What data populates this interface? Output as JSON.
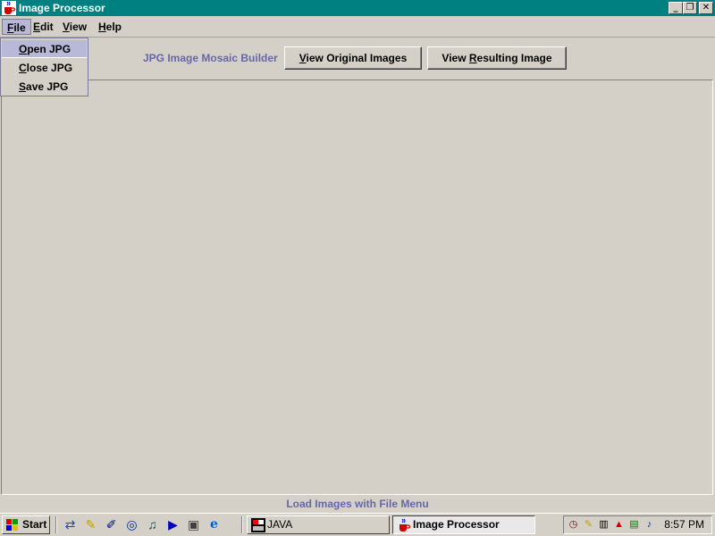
{
  "window": {
    "title": "Image Processor",
    "controls": {
      "minimize": "_",
      "restore": "❐",
      "close": "✕"
    },
    "title_icon": "java-cup-icon"
  },
  "menubar": {
    "items": [
      {
        "label": "File",
        "mnemonic": "F",
        "rest": "ile"
      },
      {
        "label": "Edit",
        "mnemonic": "E",
        "rest": "dit"
      },
      {
        "label": "View",
        "mnemonic": "V",
        "rest": "iew"
      },
      {
        "label": "Help",
        "mnemonic": "H",
        "rest": "elp"
      }
    ],
    "active": "File"
  },
  "file_menu": {
    "items": [
      {
        "mnemonic": "O",
        "rest": "pen JPG"
      },
      {
        "mnemonic": "C",
        "rest": "lose JPG"
      },
      {
        "mnemonic": "S",
        "rest": "ave JPG"
      }
    ]
  },
  "toolbar": {
    "label": "JPG Image Mosaic Builder",
    "view_original": {
      "pre": "",
      "mnemonic": "V",
      "rest": "iew Original Images"
    },
    "view_resulting": {
      "pre": "View ",
      "mnemonic": "R",
      "rest": "esulting Image"
    }
  },
  "status": {
    "text": "Load Images with File Menu"
  },
  "taskbar": {
    "start_label": "Start",
    "tasks": [
      {
        "label": "JAVA",
        "icon": "ms-dos-icon"
      },
      {
        "label": "Image Processor",
        "icon": "java-cup-icon"
      }
    ],
    "clock": "8:57 PM"
  },
  "colors": {
    "titlebar": "#008080",
    "face": "#d4d0c8",
    "accent_text": "#6666aa",
    "menu_highlight": "#b8b8d8"
  }
}
